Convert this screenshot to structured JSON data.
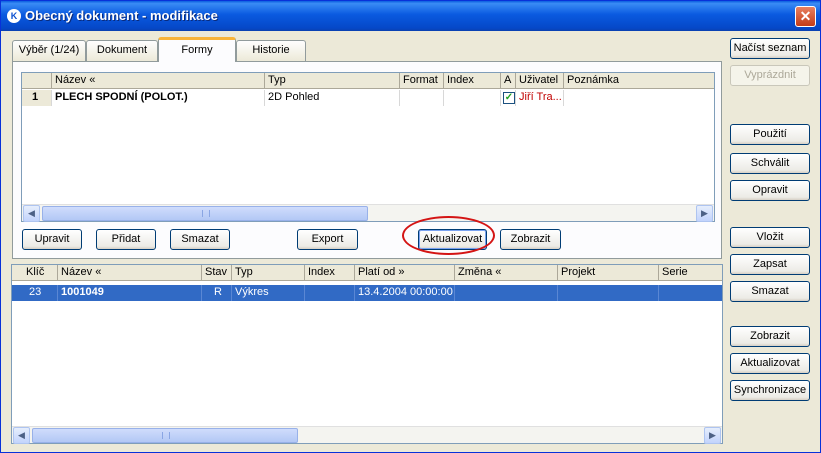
{
  "window": {
    "title": "Obecný dokument - modifikace",
    "app_icon": "K",
    "close_glyph": "✕"
  },
  "tabs": [
    {
      "label": "Výběr (1/24)"
    },
    {
      "label": "Dokument"
    },
    {
      "label": "Formy"
    },
    {
      "label": "Historie"
    }
  ],
  "forms_grid": {
    "columns": [
      "",
      "Název «",
      "Typ",
      "Format",
      "Index",
      "A",
      "Uživatel",
      "Poznámka"
    ],
    "rows": [
      {
        "num": "1",
        "nazev": "PLECH SPODNÍ (POLOT.)",
        "typ": "2D Pohled",
        "format": "",
        "index": "",
        "a_checked": true,
        "uzivatel": "Jiří Tra...",
        "poznamka": ""
      }
    ]
  },
  "forms_buttons": {
    "upravit": "Upravit",
    "pridat": "Přidat",
    "smazat": "Smazat",
    "export": "Export",
    "aktualizovat": "Aktualizovat",
    "zobrazit": "Zobrazit"
  },
  "docs_grid": {
    "columns": [
      "Klíč",
      "Název «",
      "Stav",
      "Typ",
      "Index",
      "Platí od »",
      "Změna «",
      "Projekt",
      "Serie"
    ],
    "rows": [
      {
        "klic": "23",
        "nazev": "1001049",
        "stav": "R",
        "typ": "Výkres",
        "index": "",
        "plati_od": "13.4.2004 00:00:00",
        "zmena": "",
        "projekt": "",
        "serie": ""
      }
    ]
  },
  "side_buttons": {
    "nacist_seznam": "Načíst seznam",
    "vyprazdnit": "Vyprázdnit",
    "pouziti": "Použití",
    "schvalit": "Schválit",
    "opravit": "Opravit",
    "vlozit": "Vložit",
    "zapsat": "Zapsat",
    "smazat": "Smazat",
    "zobrazit": "Zobrazit",
    "aktualizovat": "Aktualizovat",
    "synchronizace": "Synchronizace"
  },
  "scroll": {
    "left": "◀",
    "right": "▶"
  },
  "colors": {
    "title_blue": "#0a5ae0",
    "selection": "#316ac5",
    "highlight_ring": "#d41414",
    "user_red": "#c00000"
  }
}
